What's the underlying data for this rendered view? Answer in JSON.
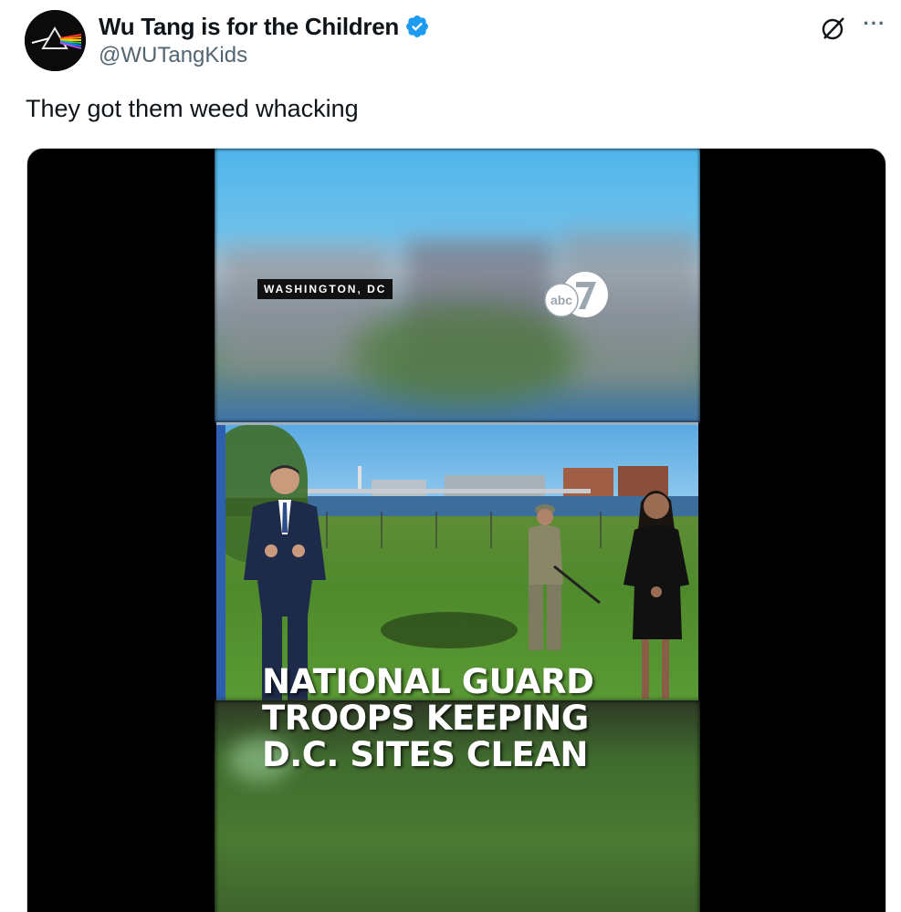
{
  "author": {
    "display_name": "Wu Tang is for the Children",
    "handle": "@WUTangKids",
    "verified": true,
    "verified_color": "#1d9bf0"
  },
  "tweet": {
    "text": "They got them weed whacking"
  },
  "actions": {
    "grok_icon": "grok-icon",
    "more_label": "···"
  },
  "media": {
    "location_tag": "WASHINGTON, DC",
    "logo_text": "abc",
    "logo_number": "7",
    "headline_lines": [
      "NATIONAL GUARD",
      "TROOPS KEEPING",
      "D.C. SITES CLEAN"
    ]
  }
}
